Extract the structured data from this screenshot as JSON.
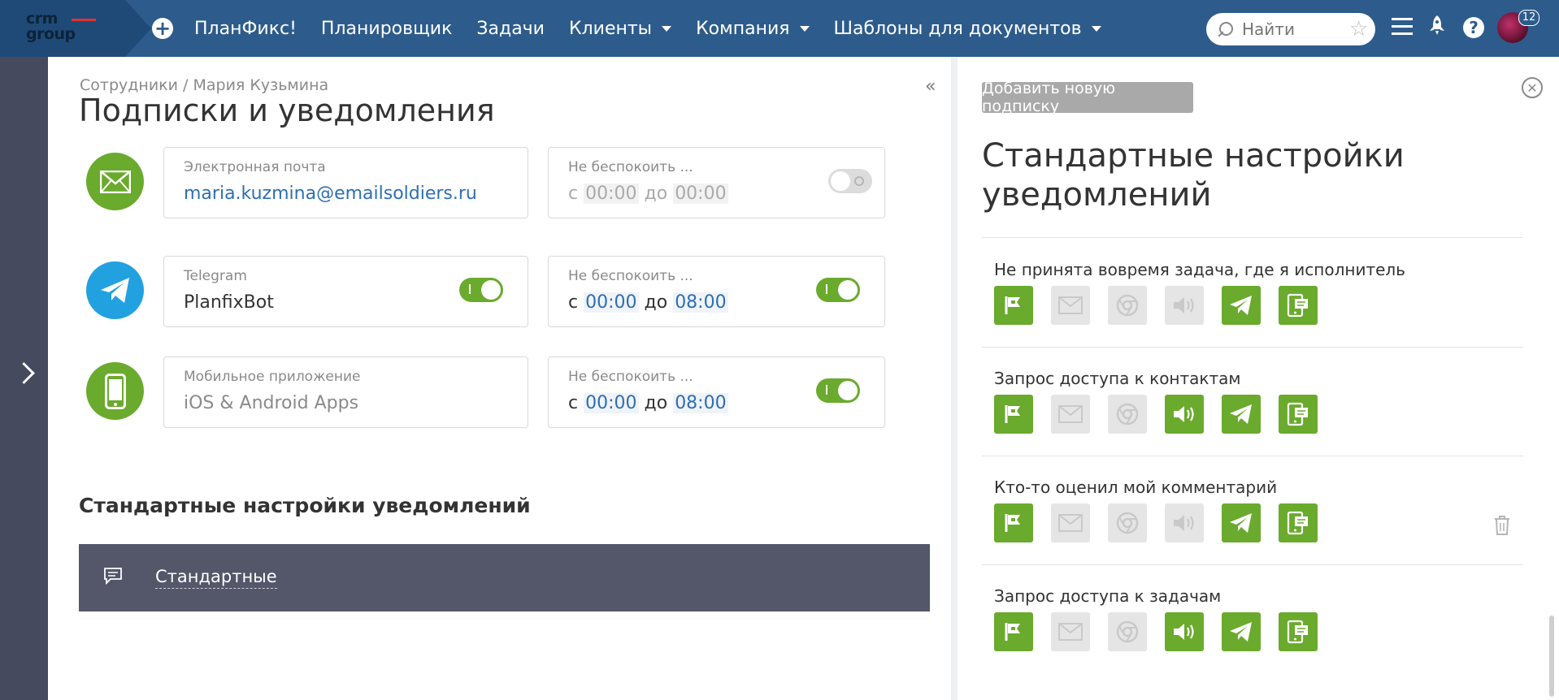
{
  "colors": {
    "topbar": "#2d5c8c",
    "accent_green": "#6aaa2d",
    "telegram_blue": "#22a1e0",
    "link_blue": "#2d6fb3",
    "dark_bar": "#535769"
  },
  "header": {
    "logo": {
      "line1": "crm",
      "line2": "group"
    },
    "add_icon": "plus-circle-icon",
    "nav": [
      {
        "label": "ПланФикс!",
        "dropdown": false
      },
      {
        "label": "Планировщик",
        "dropdown": false
      },
      {
        "label": "Задачи",
        "dropdown": false
      },
      {
        "label": "Клиенты",
        "dropdown": true
      },
      {
        "label": "Компания",
        "dropdown": true
      },
      {
        "label": "Шаблоны для документов",
        "dropdown": true
      }
    ],
    "search": {
      "placeholder": "Найти",
      "value": ""
    },
    "icons": [
      "menu-icon",
      "rocket-icon",
      "help-icon"
    ],
    "notification_count": "12"
  },
  "main": {
    "breadcrumb": "Сотрудники / Мария Кузьмина",
    "title": "Подписки и уведомления",
    "channels": [
      {
        "icon": "envelope-icon",
        "label": "Электронная почта",
        "value": "maria.kuzmina@emailsoldiers.ru",
        "enabled": null,
        "dnd": {
          "label": "Не беспокоить ...",
          "prefix": "с",
          "from": "00:00",
          "mid": "до",
          "to": "00:00",
          "enabled": false
        }
      },
      {
        "icon": "telegram-icon",
        "label": "Telegram",
        "value": "PlanfixBot",
        "enabled": true,
        "dnd": {
          "label": "Не беспокоить ...",
          "prefix": "с",
          "from": "00:00",
          "mid": "до",
          "to": "08:00",
          "enabled": true
        }
      },
      {
        "icon": "mobile-phone-icon",
        "label": "Мобильное приложение",
        "value": "iOS & Android Apps",
        "enabled": null,
        "dnd": {
          "label": "Не беспокоить ...",
          "prefix": "с",
          "from": "00:00",
          "mid": "до",
          "to": "08:00",
          "enabled": true
        }
      }
    ],
    "section_title": "Стандартные настройки уведомлений",
    "standard_item": {
      "icon": "comment-icon",
      "label": "Стандартные"
    }
  },
  "panel": {
    "add_button": "Добавить новую подписку",
    "title": "Стандартные настройки уведомлений",
    "subscriptions": [
      {
        "label": "Не принята вовремя задача, где я исполнитель",
        "channels": [
          true,
          false,
          false,
          false,
          true,
          true
        ],
        "deletable": false
      },
      {
        "label": "Запрос доступа к контактам",
        "channels": [
          true,
          false,
          false,
          true,
          true,
          true
        ],
        "deletable": false
      },
      {
        "label": "Кто-то оценил мой комментарий",
        "channels": [
          true,
          false,
          false,
          false,
          true,
          true
        ],
        "deletable": true
      },
      {
        "label": "Запрос доступа к задачам",
        "channels": [
          true,
          false,
          false,
          true,
          true,
          true
        ],
        "deletable": false
      }
    ],
    "channel_icons": [
      "flag-icon",
      "envelope-icon",
      "browser-icon",
      "sound-icon",
      "telegram-icon",
      "mobile-notification-icon"
    ]
  }
}
